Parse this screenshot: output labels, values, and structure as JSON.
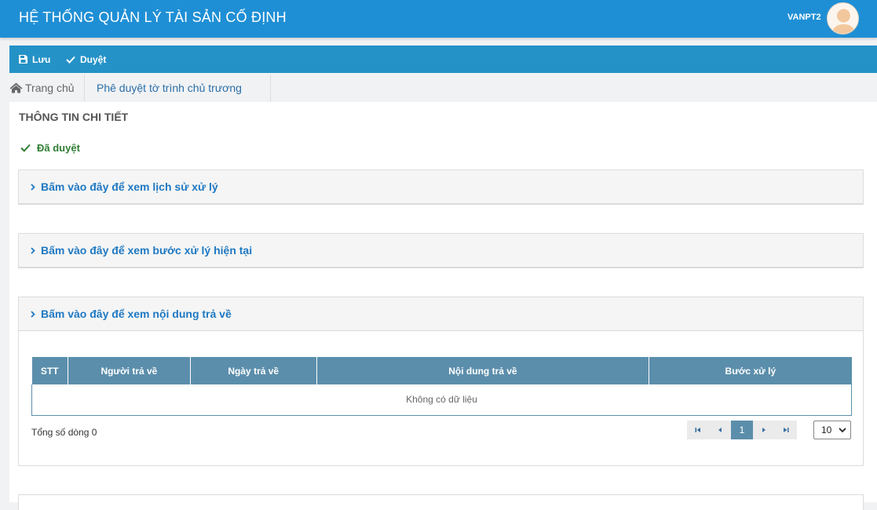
{
  "header": {
    "title": "HỆ THỐNG QUẢN LÝ TÀI SẢN CỐ ĐỊNH",
    "username": "VANPT2",
    "brand_color": "#1f8fd5"
  },
  "toolbar": {
    "save_label": "Lưu",
    "approve_label": "Duyệt",
    "save_icon": "save-icon",
    "approve_icon": "check-icon"
  },
  "breadcrumb": {
    "home_label": "Trang chủ",
    "current_label": "Phê duyệt tờ trình chủ trương"
  },
  "main": {
    "section_title": "THÔNG TIN CHI TIẾT",
    "status_text": "Đã duyệt",
    "status_color": "#2e7d32",
    "panels": [
      {
        "label": "Bấm vào đây để xem lịch sử xử lý"
      },
      {
        "label": "Bấm vào đây để xem bước xử lý hiện tại"
      },
      {
        "label": "Bấm vào đây để xem nội dung trả về"
      }
    ]
  },
  "returns_table": {
    "columns": [
      "STT",
      "Người trả về",
      "Ngày trả về",
      "Nội dung trả về",
      "Bước xử lý"
    ],
    "empty_text": "Không có dữ liệu",
    "total_text": "Tổng số dòng 0",
    "current_page": "1",
    "page_size": "10",
    "header_color": "#5b8eab"
  }
}
